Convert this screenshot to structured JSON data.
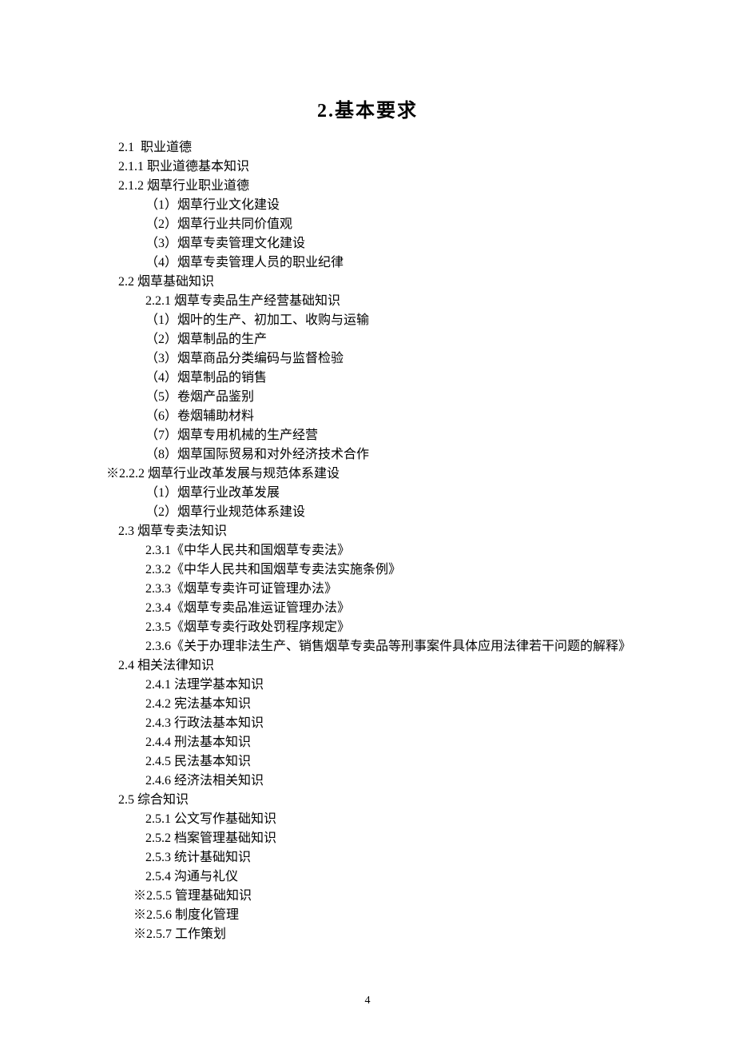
{
  "title": "2.基本要求",
  "page_number": "4",
  "lines": [
    {
      "cls": "indent0",
      "text": "2.1  职业道德"
    },
    {
      "cls": "indent0",
      "text": "2.1.1 职业道德基本知识"
    },
    {
      "cls": "indent0",
      "text": "2.1.2 烟草行业职业道德"
    },
    {
      "cls": "indent2",
      "text": "（1）烟草行业文化建设"
    },
    {
      "cls": "indent2",
      "text": "（2）烟草行业共同价值观"
    },
    {
      "cls": "indent2",
      "text": "（3）烟草专卖管理文化建设"
    },
    {
      "cls": "indent2",
      "text": "（4）烟草专卖管理人员的职业纪律"
    },
    {
      "cls": "indent0",
      "text": "2.2 烟草基础知识"
    },
    {
      "cls": "indent1",
      "text": "2.2.1 烟草专卖品生产经营基础知识"
    },
    {
      "cls": "indent2",
      "text": "（1）烟叶的生产、初加工、收购与运输"
    },
    {
      "cls": "indent2",
      "text": "（2）烟草制品的生产"
    },
    {
      "cls": "indent2",
      "text": "（3）烟草商品分类编码与监督检验"
    },
    {
      "cls": "indent2",
      "text": "（4）烟草制品的销售"
    },
    {
      "cls": "indent2",
      "text": "（5）卷烟产品鉴别"
    },
    {
      "cls": "indent2",
      "text": "（6）卷烟辅助材料"
    },
    {
      "cls": "indent2",
      "text": "（7）烟草专用机械的生产经营"
    },
    {
      "cls": "indent2",
      "text": "（8）烟草国际贸易和对外经济技术合作"
    },
    {
      "cls": "star0",
      "text": "※2.2.2 烟草行业改革发展与规范体系建设"
    },
    {
      "cls": "indent2",
      "text": "（1）烟草行业改革发展"
    },
    {
      "cls": "indent2",
      "text": "（2）烟草行业规范体系建设"
    },
    {
      "cls": "indent0",
      "text": "2.3 烟草专卖法知识"
    },
    {
      "cls": "indent1",
      "text": "2.3.1《中华人民共和国烟草专卖法》"
    },
    {
      "cls": "indent1",
      "text": "2.3.2《中华人民共和国烟草专卖法实施条例》"
    },
    {
      "cls": "indent1",
      "text": "2.3.3《烟草专卖许可证管理办法》"
    },
    {
      "cls": "indent1",
      "text": "2.3.4《烟草专卖品准运证管理办法》"
    },
    {
      "cls": "indent1",
      "text": "2.3.5《烟草专卖行政处罚程序规定》"
    },
    {
      "cls": "indent1",
      "text": "2.3.6《关于办理非法生产、销售烟草专卖品等刑事案件具体应用法律若干问题的解释》"
    },
    {
      "cls": "indent0",
      "text": "2.4 相关法律知识"
    },
    {
      "cls": "indent1",
      "text": "2.4.1 法理学基本知识"
    },
    {
      "cls": "indent1",
      "text": "2.4.2 宪法基本知识"
    },
    {
      "cls": "indent1",
      "text": "2.4.3 行政法基本知识"
    },
    {
      "cls": "indent1",
      "text": "2.4.4 刑法基本知识"
    },
    {
      "cls": "indent1",
      "text": "2.4.5 民法基本知识"
    },
    {
      "cls": "indent1",
      "text": "2.4.6 经济法相关知识"
    },
    {
      "cls": "indent0",
      "text": "2.5 综合知识"
    },
    {
      "cls": "indent1",
      "text": "2.5.1 公文写作基础知识"
    },
    {
      "cls": "indent1",
      "text": "2.5.2 档案管理基础知识"
    },
    {
      "cls": "indent1",
      "text": "2.5.3 统计基础知识"
    },
    {
      "cls": "indent1",
      "text": "2.5.4 沟通与礼仪"
    },
    {
      "cls": "star1",
      "text": "※2.5.5 管理基础知识"
    },
    {
      "cls": "star1",
      "text": "※2.5.6 制度化管理"
    },
    {
      "cls": "star1",
      "text": "※2.5.7 工作策划"
    }
  ]
}
